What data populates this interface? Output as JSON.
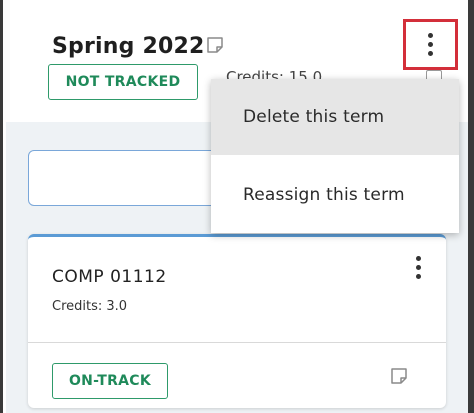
{
  "term": {
    "title": "Spring 2022",
    "status": "NOT TRACKED",
    "credits_partial": "Credits: 15.0",
    "menu_icon": "kebab-vertical-icon",
    "note_icon": "note-icon"
  },
  "menu": {
    "items": [
      {
        "label": "Delete this term"
      },
      {
        "label": "Reassign this term"
      }
    ]
  },
  "course": {
    "code": "COMP 01112",
    "credits": "Credits: 3.0",
    "status": "ON-TRACK",
    "menu_icon": "kebab-vertical-icon",
    "note_icon": "note-icon"
  },
  "colors": {
    "status_green": "#2e9a6a",
    "highlight_red": "#d32f3a",
    "card_accent": "#5b9bd5",
    "body_bg": "#eef2f5",
    "menu_hover": "#e6e6e6"
  }
}
